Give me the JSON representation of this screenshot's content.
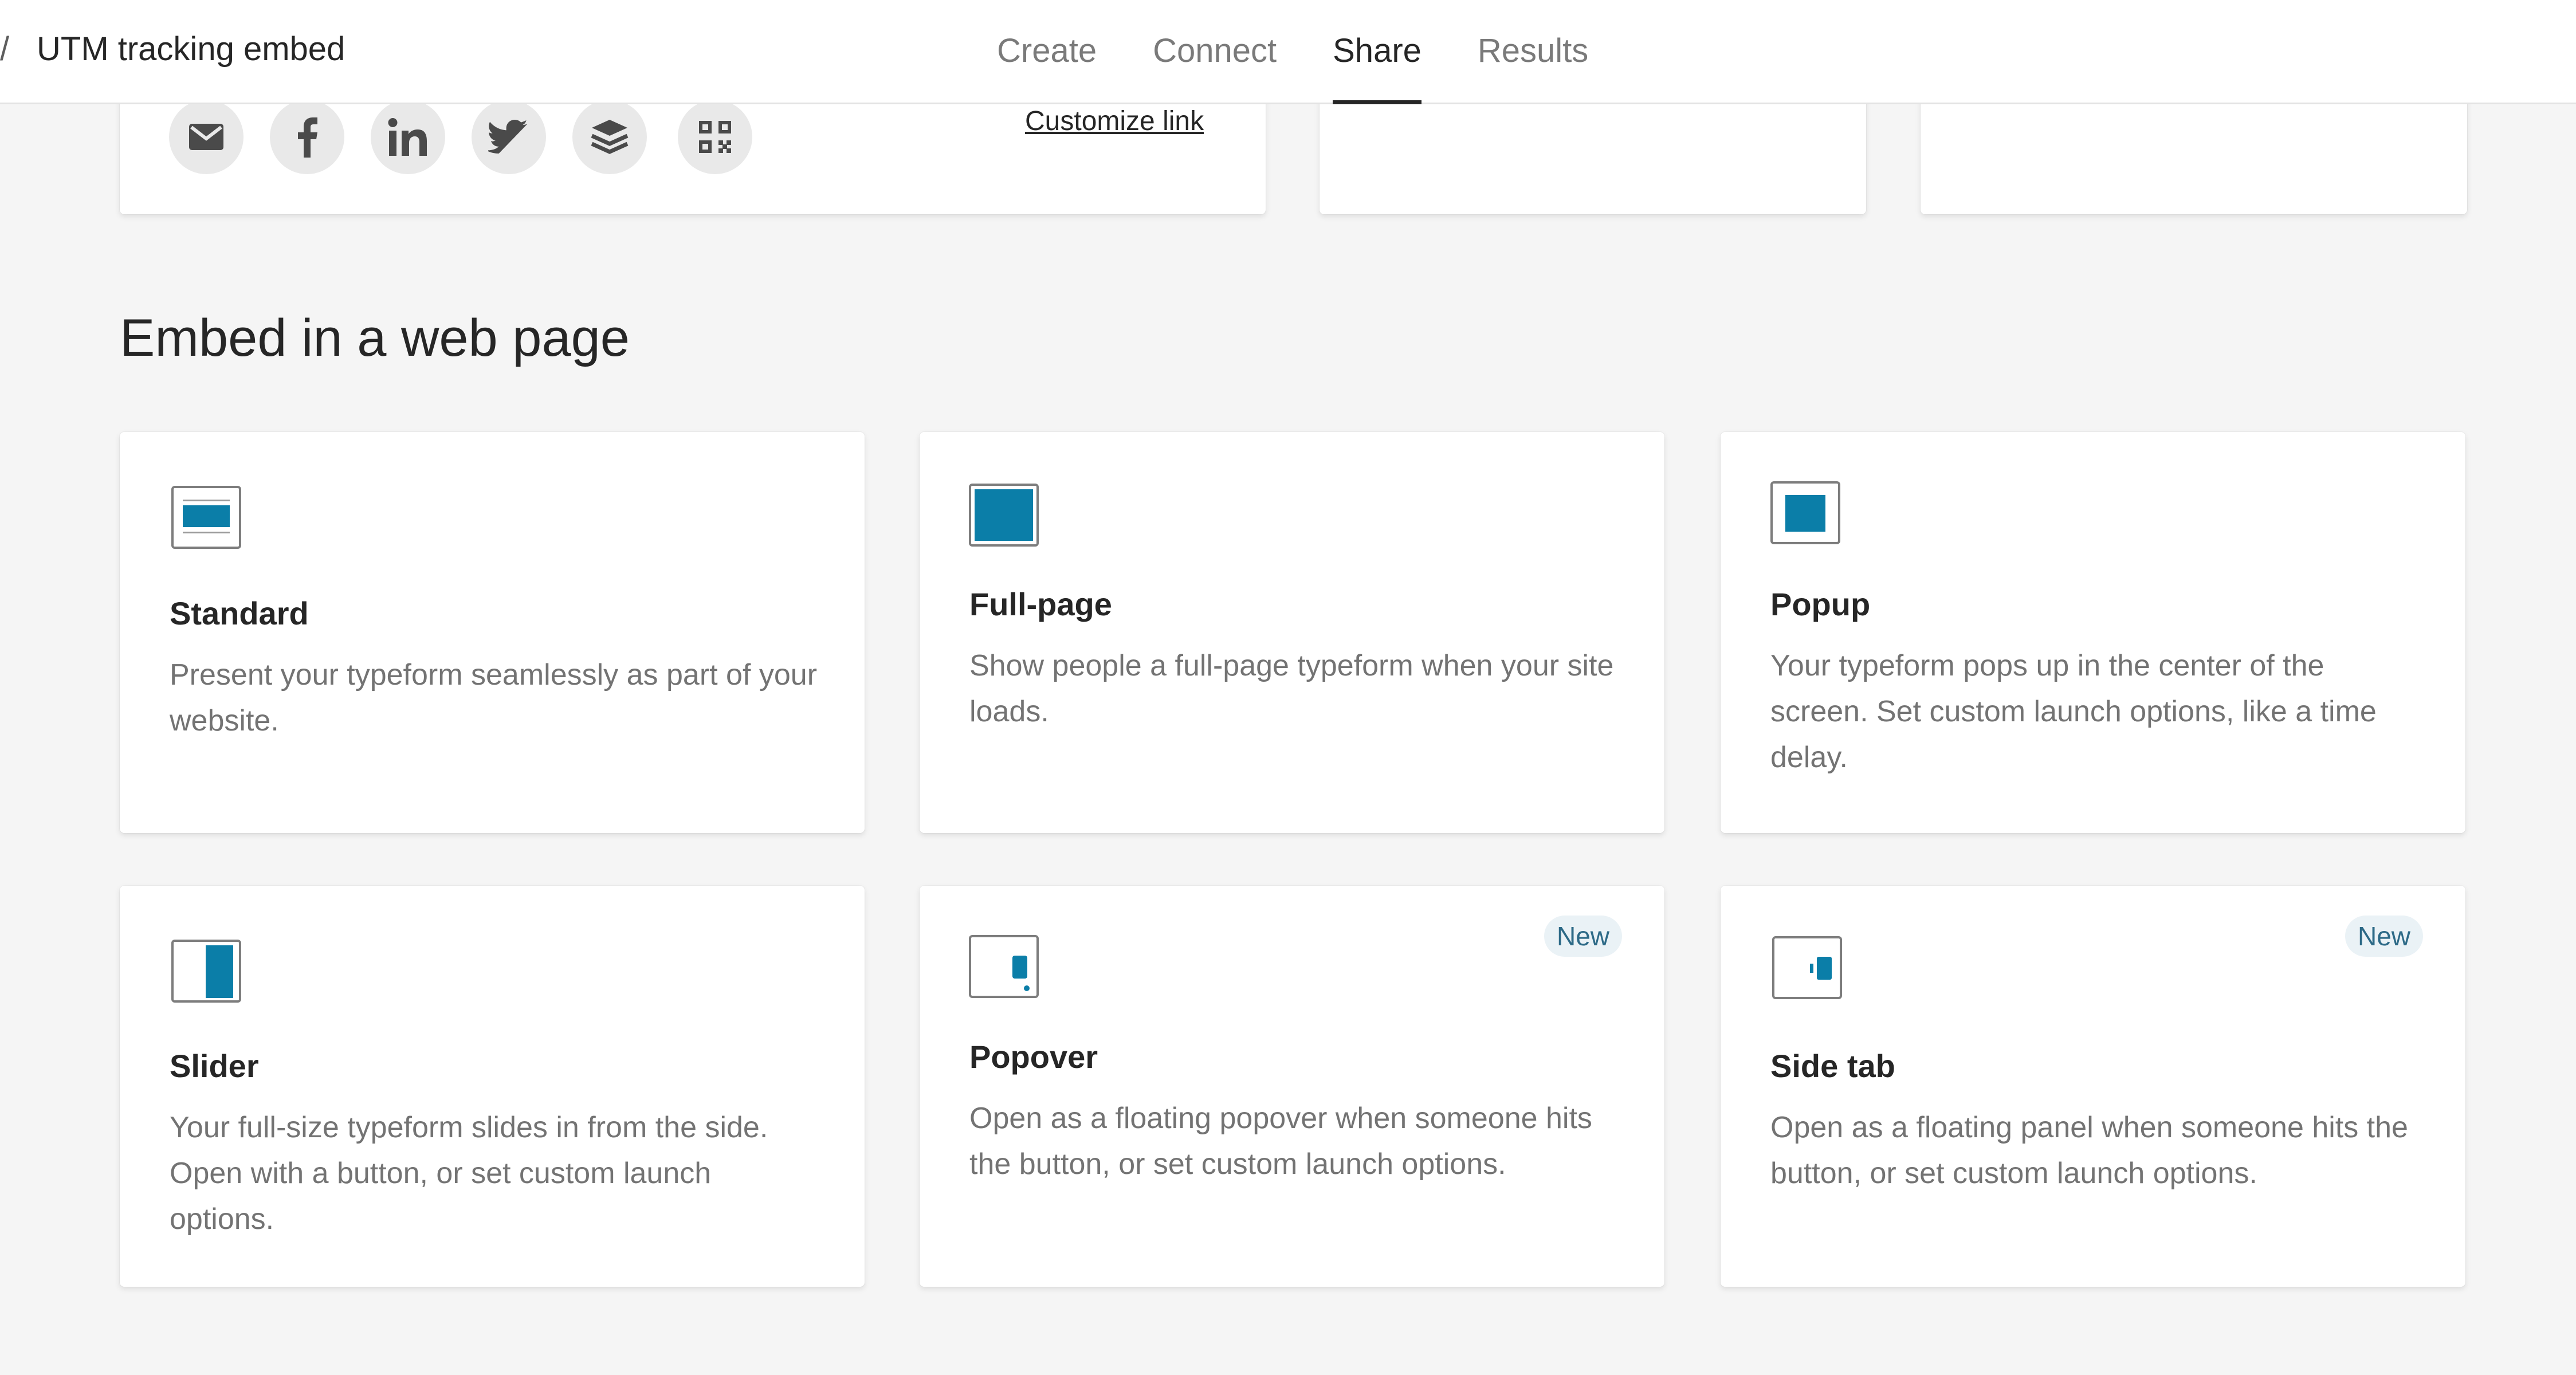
{
  "header": {
    "breadcrumb_separator": "/",
    "title": "UTM tracking embed",
    "tabs": [
      {
        "label": "Create",
        "active": false
      },
      {
        "label": "Connect",
        "active": false
      },
      {
        "label": "Share",
        "active": true
      },
      {
        "label": "Results",
        "active": false
      }
    ]
  },
  "share_link": {
    "icons": [
      "email-icon",
      "facebook-icon",
      "linkedin-icon",
      "twitter-icon",
      "buffer-icon",
      "qr-code-icon"
    ],
    "customize_label": "Customize link"
  },
  "embed_section": {
    "title": "Embed in a web page",
    "options": [
      {
        "name": "Standard",
        "description": "Present your typeform seamlessly as part of your website.",
        "badge": "",
        "icon": "standard-embed-icon"
      },
      {
        "name": "Full-page",
        "description": "Show people a full-page typeform when your site loads.",
        "badge": "",
        "icon": "full-page-embed-icon"
      },
      {
        "name": "Popup",
        "description": "Your typeform pops up in the center of the screen. Set custom launch options, like a time delay.",
        "badge": "",
        "icon": "popup-embed-icon"
      },
      {
        "name": "Slider",
        "description": "Your full-size typeform slides in from the side. Open with a button, or set custom launch options.",
        "badge": "",
        "icon": "slider-embed-icon"
      },
      {
        "name": "Popover",
        "description": "Open as a floating popover when someone hits the button, or set custom launch options.",
        "badge": "New",
        "icon": "popover-embed-icon"
      },
      {
        "name": "Side tab",
        "description": "Open as a floating panel when someone hits the button, or set custom launch options.",
        "badge": "New",
        "icon": "side-tab-embed-icon"
      }
    ]
  },
  "colors": {
    "accent": "#0b7ea8",
    "badge_bg": "#eaf2f6",
    "badge_text": "#2d6a87",
    "page_bg": "#f5f5f5"
  }
}
